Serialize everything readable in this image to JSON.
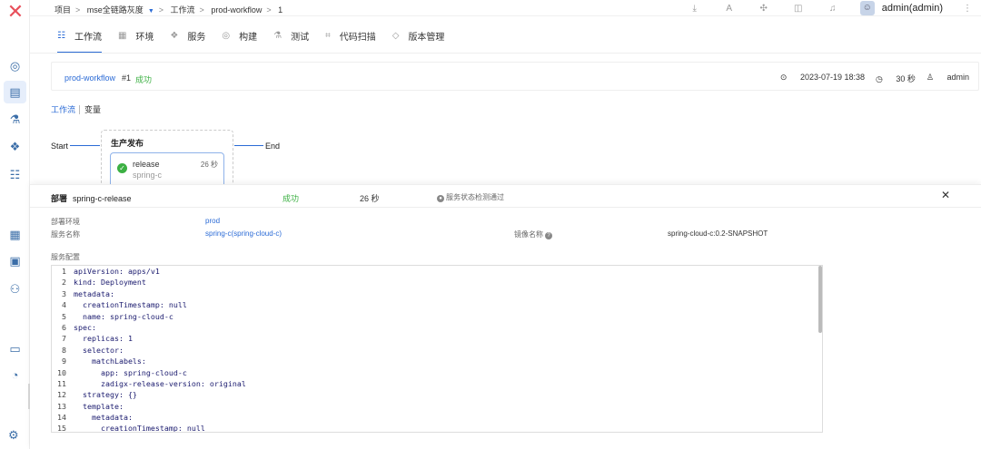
{
  "breadcrumb": {
    "items": [
      "项目",
      "mse全链路灰度",
      "工作流",
      "prod-workflow",
      "1"
    ]
  },
  "topbar": {
    "user": "admin(admin)",
    "icons": [
      "download-icon",
      "text-icon",
      "plugin-icon",
      "book-icon",
      "bell-icon"
    ]
  },
  "tabs": [
    {
      "label": "工作流",
      "icon": "workflow-icon",
      "active": true
    },
    {
      "label": "环境",
      "icon": "env-icon"
    },
    {
      "label": "服务",
      "icon": "service-icon"
    },
    {
      "label": "构建",
      "icon": "build-icon"
    },
    {
      "label": "测试",
      "icon": "test-icon"
    },
    {
      "label": "代码扫描",
      "icon": "scan-icon"
    },
    {
      "label": "版本管理",
      "icon": "version-icon"
    }
  ],
  "run": {
    "name": "prod-workflow",
    "number": "#1",
    "status": "成功",
    "time": "2023-07-19 18:38",
    "duration": "30 秒",
    "user": "admin"
  },
  "subtabs": {
    "workflow": "工作流",
    "variables": "变量"
  },
  "flow": {
    "start": "Start",
    "end": "End",
    "stage": "生产发布",
    "job": {
      "name": "release",
      "service": "spring-c",
      "time": "26 秒"
    }
  },
  "panel": {
    "type_label": "部署",
    "job": "spring-c-release",
    "status": "成功",
    "time": "26 秒",
    "check": "服务状态检测通过",
    "env_label": "部署环境",
    "env_value": "prod",
    "svc_label": "服务名称",
    "svc_value": "spring-c(spring-cloud-c)",
    "img_label": "镜像名称",
    "img_value": "spring-cloud-c:0.2-SNAPSHOT",
    "config_label": "服务配置"
  },
  "code_lines": [
    {
      "n": "1",
      "t": "apiVersion: apps/v1"
    },
    {
      "n": "2",
      "t": "kind: Deployment"
    },
    {
      "n": "3",
      "t": "metadata:"
    },
    {
      "n": "4",
      "t": "  creationTimestamp: null"
    },
    {
      "n": "5",
      "t": "  name: spring-cloud-c"
    },
    {
      "n": "6",
      "t": "spec:"
    },
    {
      "n": "7",
      "t": "  replicas: 1"
    },
    {
      "n": "8",
      "t": "  selector:"
    },
    {
      "n": "9",
      "t": "    matchLabels:"
    },
    {
      "n": "10",
      "t": "      app: spring-cloud-c"
    },
    {
      "n": "11",
      "t": "      zadigx-release-version: original"
    },
    {
      "n": "12",
      "t": "  strategy: {}"
    },
    {
      "n": "13",
      "t": "  template:"
    },
    {
      "n": "14",
      "t": "    metadata:"
    },
    {
      "n": "15",
      "t": "      creationTimestamp: null"
    }
  ]
}
